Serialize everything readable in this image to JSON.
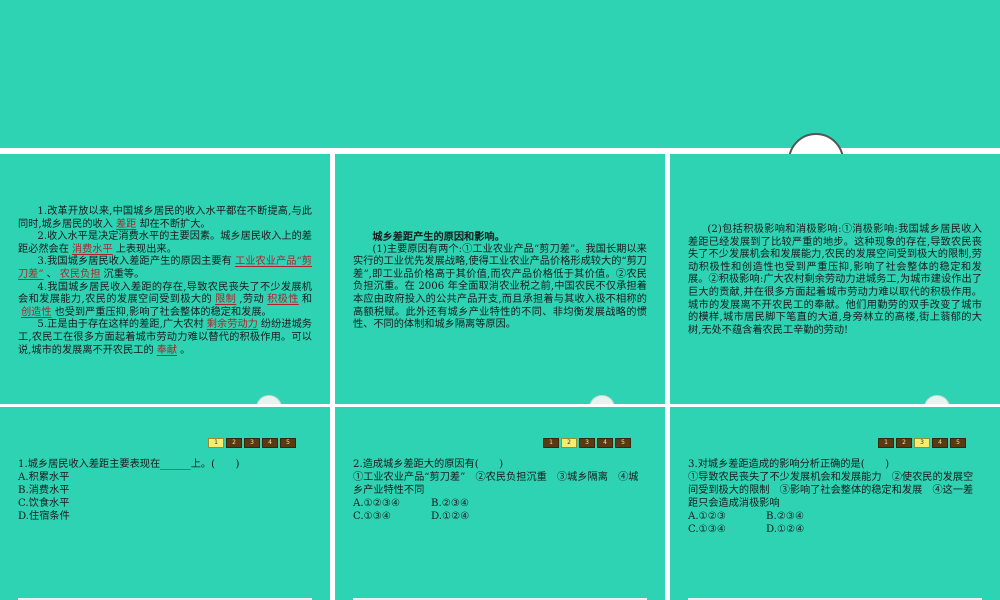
{
  "colors": {
    "slide_bg": "#2ed3b4",
    "blank_text": "#b0232a",
    "pager_bg": "#5a3a12",
    "pager_active": "#f3ee6e"
  },
  "slide1": {
    "p1_a": "1.改革开放以来,中国城乡居民的收入水平都在不断提高,与此同时,城乡居民的收入",
    "p1_blank": "差距",
    "p1_b": "却在不断扩大。",
    "p2_a": "2.收入水平是决定消费水平的主要因素。城乡居民收入上的差距必然会在",
    "p2_blank": "消费水平",
    "p2_b": "上表现出来。",
    "p3_a": "3.我国城乡居民收入差距产生的原因主要有",
    "p3_blank1": "工业农业产品“剪刀差”",
    "p3_mid": "、",
    "p3_blank2": "农民负担",
    "p3_b": "沉重等。",
    "p4_a": "4.我国城乡居民收入差距的存在,导致农民丧失了不少发展机会和发展能力,农民的发展空间受到极大的",
    "p4_blank1": "限制",
    "p4_mid1": ",劳动",
    "p4_blank2": "积极性",
    "p4_mid2": "和",
    "p4_blank3": "创造性",
    "p4_b": "也受到严重压抑,影响了社会整体的稳定和发展。",
    "p5_a": "5.正是由于存在这样的差距,广大农村",
    "p5_blank1": "剩余劳动力",
    "p5_mid": "纷纷进城务工,农民工在很多方面起着城市劳动力难以替代的积极作用。可以说,城市的发展离不开农民工的",
    "p5_blank2": "奉献",
    "p5_b": "。"
  },
  "slide2": {
    "title": "城乡差距产生的原因和影响。",
    "para": "(1)主要原因有两个:①工业农业产品“剪刀差”。我国长期以来实行的工业优先发展战略,使得工业农业产品价格形成较大的“剪刀差”,即工业品价格高于其价值,而农产品价格低于其价值。②农民负担沉重。在 2006 年全面取消农业税之前,中国农民不仅承担着本应由政府投入的公共产品开支,而且承担着与其收入极不相称的高额税赋。此外还有城乡产业特性的不同、非均衡发展战略的惯性、不同的体制和城乡隔离等原因。"
  },
  "slide3": {
    "para": "(2)包括积极影响和消极影响:①消极影响:我国城乡居民收入差距已经发展到了比较严重的地步。这种现象的存在,导致农民丧失了不少发展机会和发展能力,农民的发展空间受到极大的限制,劳动积极性和创造性也受到严重压抑,影响了社会整体的稳定和发展。②积极影响:广大农村剩余劳动力进城务工,为城市建设作出了巨大的贡献,并在很多方面起着城市劳动力难以取代的积极作用。城市的发展离不开农民工的奉献。他们用勤劳的双手改变了城市的模样,城市居民脚下笔直的大道,身旁林立的高楼,街上蓊郁的大树,无处不蕴含着农民工辛勤的劳动!"
  },
  "pager": [
    "1",
    "2",
    "3",
    "4",
    "5"
  ],
  "q1": {
    "stem": "1.城乡居民收入差距主要表现在______上。(　　)",
    "a": "A.积累水平",
    "b": "B.消费水平",
    "c": "C.饮食水平",
    "d": "D.住宿条件"
  },
  "q2": {
    "stem": "2.造成城乡差距大的原因有(　　)",
    "items": "①工业农业产品“剪刀差”　②农民负担沉重　③城乡隔离　④城乡产业特性不同",
    "a": "A.①②③④",
    "b": "B.②③④",
    "c": "C.①③④",
    "d": "D.①②④"
  },
  "q3": {
    "stem": "3.对城乡差距造成的影响分析正确的是(　　)",
    "items": "①导致农民丧失了不少发展机会和发展能力　②使农民的发展空间受到极大的限制　③影响了社会整体的稳定和发展　④这一差距只会造成消极影响",
    "a": "A.①②③",
    "b": "B.②③④",
    "c": "C.①③④",
    "d": "D.①②④"
  }
}
